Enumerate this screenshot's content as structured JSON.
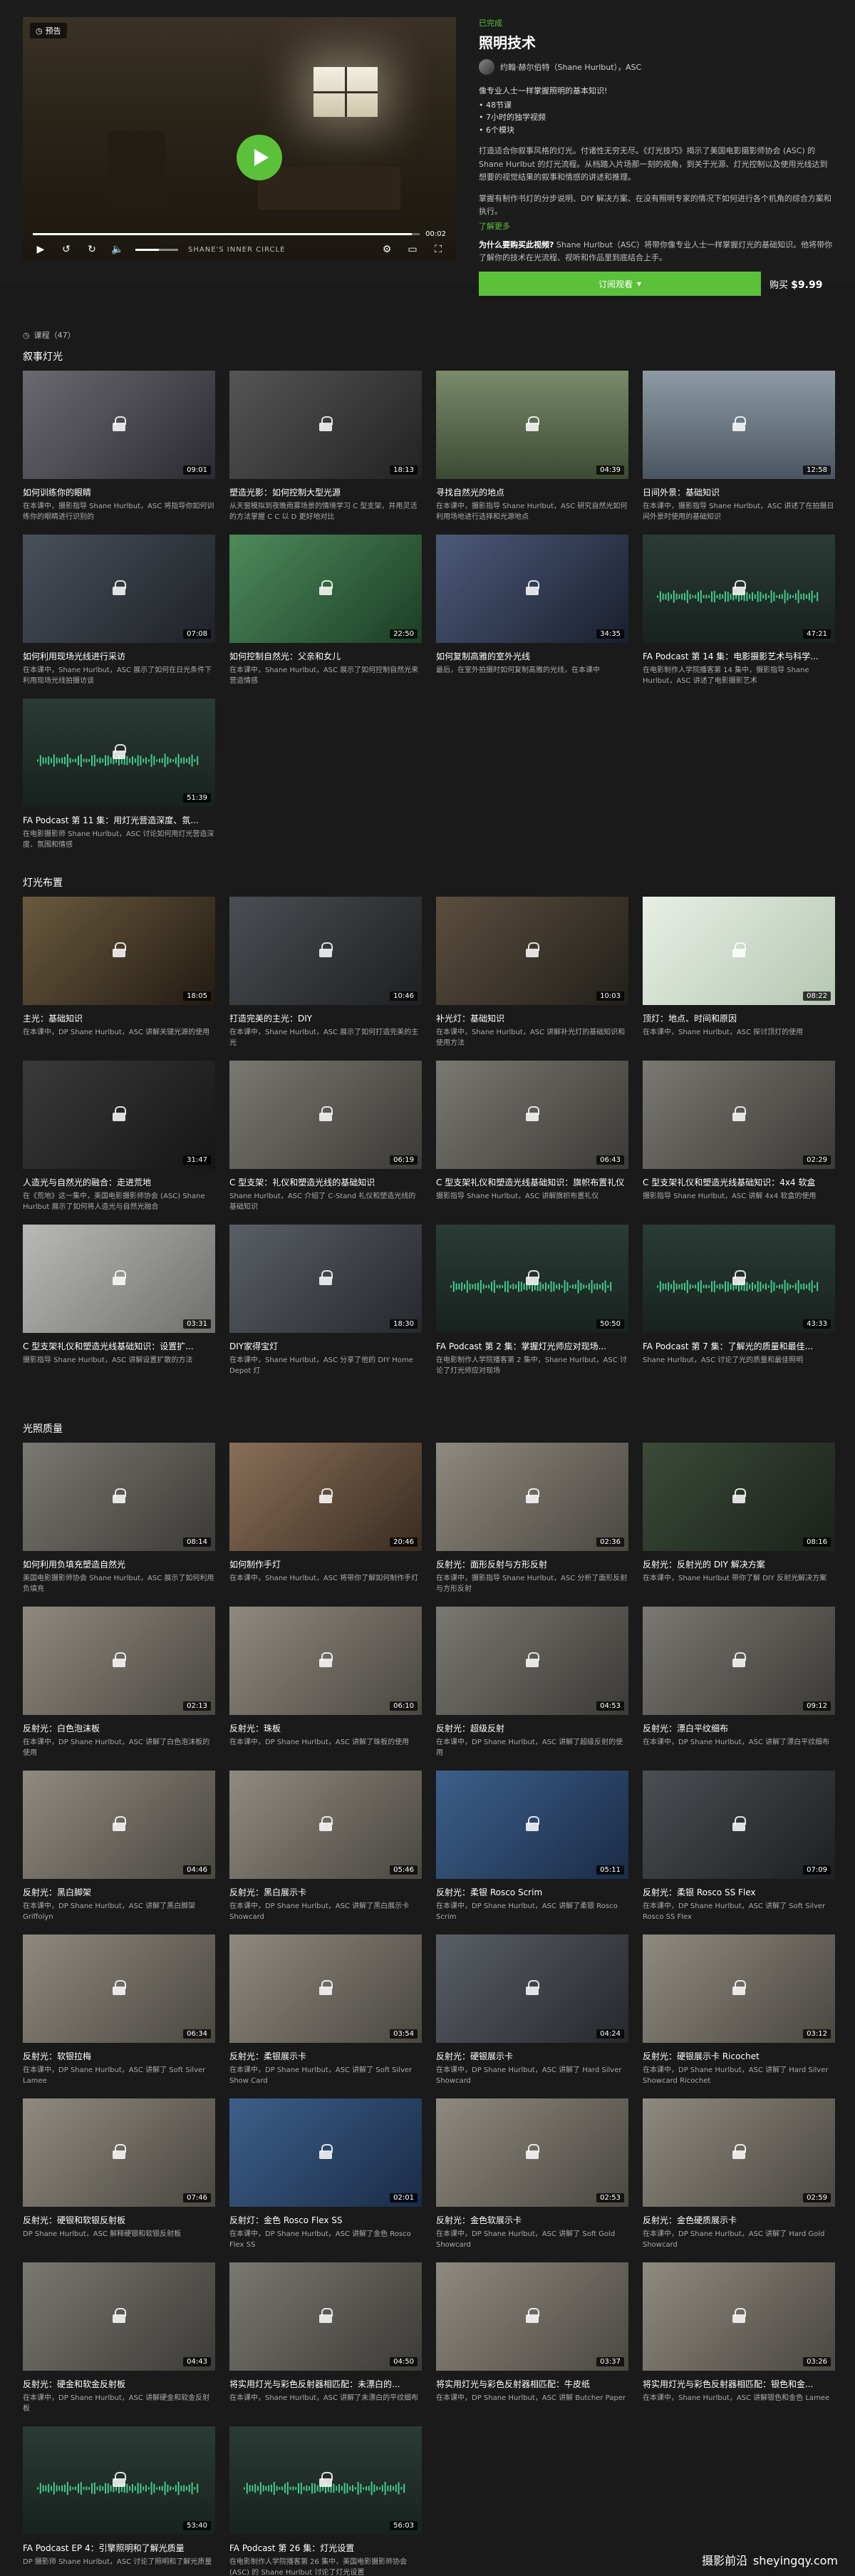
{
  "player": {
    "badge": "预告",
    "time_total": "00:02",
    "progress": 0.98,
    "volume": 0.55,
    "watermark": "SHANE'S INNER CIRCLE"
  },
  "course": {
    "status": "已完成",
    "title": "照明技术",
    "instructor": "约翰·赫尔伯特（Shane Hurlbut），ASC",
    "lead": "像专业人士一样掌握照明的基本知识!",
    "bullets": [
      "48节课",
      "7小时的独学视频",
      "6个模块"
    ],
    "desc1": "打造适合你叙事风格的灯光。付诸性无穷无尽。《灯光技巧》揭示了美国电影摄影师协会 (ASC) 的 Shane Hurlbut 的灯光流程。从档踏入片场那一刻的视角，到关于光源、灯光控制以及使用光线达到想要的视觉结果的叙事和情感的讲述和推理。",
    "desc2": "掌握有制作书灯的分步说明、DIY 解决方案、在没有照明专家的情况下如何进行各个机角的综合方案和执行。",
    "more": "了解更多",
    "why_label": "为什么要购买此视频?",
    "why_text": "Shane Hurlbut（ASC）将带你像专业人士一样掌握灯光的基础知识。他将带你了解你的技术在光流程、视听和作品里到底结合上手。",
    "subscribe": "订阅观看",
    "buy_label": "购买",
    "price": "$9.99"
  },
  "lessons_count": "课程（47）",
  "sections": [
    {
      "title": "叙事灯光",
      "cards": [
        {
          "title": "如何训练你的眼睛",
          "desc": "在本课中，摄影指导 Shane Hurlbut，ASC 将指导你如何训练你的眼睛进行识别的",
          "dur": "09:01",
          "theme": "woman"
        },
        {
          "title": "塑造光影：如何控制大型光源",
          "desc": "从天窗模拟到夜晚雨雾场景的情境学习 C 型支架，并用灵活的方法掌握 C C 以 D 更好地对比",
          "dur": "18:13",
          "theme": "shaping"
        },
        {
          "title": "寻找自然光的地点",
          "desc": "在本课中，摄影指导 Shane Hurlbut，ASC 研究自然光如何利用场地进行选择和光源地点",
          "dur": "04:39",
          "theme": "outdoor"
        },
        {
          "title": "日间外景：基础知识",
          "desc": "在本课中，摄影指导 Shane Hurlbut，ASC 讲述了在拍摄日间外景时使用的基础知识",
          "dur": "12:58",
          "theme": "street"
        },
        {
          "title": "如何利用现场光线进行采访",
          "desc": "在本课中，Shane Hurlbut，ASC 展示了如何在日光条件下利用现场光线拍摄访谈",
          "dur": "07:08",
          "theme": "interview"
        },
        {
          "title": "如何控制自然光：父亲和女儿",
          "desc": "在本课中，Shane Hurlbut，ASC 展示了如何控制自然光来营造情感",
          "dur": "22:50",
          "theme": "green"
        },
        {
          "title": "如何复制高雅的室外光线",
          "desc": "最后，在室外拍摄时如何复制高雅的光线，在本课中",
          "dur": "34:35",
          "theme": "twoshot"
        },
        {
          "title": "FA Podcast 第 14 集：电影摄影艺术与科学...",
          "desc": "在电影制作人学院播客第 14 集中，摄影指导 Shane Hurlbut，ASC 讲述了电影摄影艺术",
          "dur": "47:21",
          "theme": "podcast"
        },
        {
          "title": "FA Podcast 第 11 集：用灯光营造深度、氛...",
          "desc": "在电影摄影师 Shane Hurlbut，ASC 讨论如何用灯光营造深度、氛围和情感",
          "dur": "51:39",
          "theme": "podcast"
        }
      ]
    },
    {
      "title": "灯光布置",
      "cards": [
        {
          "title": "主光：基础知识",
          "desc": "在本课中，DP Shane Hurlbut，ASC 讲解关键光源的使用",
          "dur": "18:05",
          "theme": "window"
        },
        {
          "title": "打造完美的主光：DIY",
          "desc": "在本课中，Shane Hurlbut，ASC 展示了如何打造完美的主光",
          "dur": "10:46",
          "theme": "man"
        },
        {
          "title": "补光灯：基础知识",
          "desc": "在本课中，Shane Hurlbut，ASC 讲解补光灯的基础知识和使用方法",
          "dur": "10:03",
          "theme": "room"
        },
        {
          "title": "顶灯：地点、时间和原因",
          "desc": "在本课中，Shane Hurlbut，ASC 探讨顶灯的使用",
          "dur": "08:22",
          "theme": "slide"
        },
        {
          "title": "人造光与自然光的融合：走进荒地",
          "desc": "在《荒地》这一集中，美国电影摄影师协会 (ASC) Shane Hurlbut 展示了如何将人造光与自然光融合",
          "dur": "31:47",
          "theme": "onset"
        },
        {
          "title": "C 型支架：礼仪和塑造光线的基础知识",
          "desc": "Shane Hurlbut，ASC 介绍了 C-Stand 礼仪和塑造光线的基础知识",
          "dur": "06:19",
          "theme": "studio"
        },
        {
          "title": "C 型支架礼仪和塑造光线基础知识：旗帜布置礼仪",
          "desc": "摄影指导 Shane Hurlbut，ASC 讲解旗帜布置礼仪",
          "dur": "06:43",
          "theme": "studio"
        },
        {
          "title": "C 型支架礼仪和塑造光线基础知识：4x4 软盒",
          "desc": "摄影指导 Shane Hurlbut，ASC 讲解 4x4 软盒的使用",
          "dur": "02:29",
          "theme": "studio"
        },
        {
          "title": "C 型支架礼仪和塑造光线基础知识：设置扩...",
          "desc": "摄影指导 Shane Hurlbut，ASC 讲解设置扩散的方法",
          "dur": "03:31",
          "theme": "white"
        },
        {
          "title": "DIY家得宝灯",
          "desc": "在本课中，Shane Hurlbut，ASC 分享了他的 DIY Home Depot 灯",
          "dur": "18:30",
          "theme": "man2"
        },
        {
          "title": "FA Podcast 第 2 集：掌握灯光师应对现场...",
          "desc": "在电影制作人学院播客第 2 集中，Shane Hurlbut，ASC 讨论了灯光师应对现场",
          "dur": "50:50",
          "theme": "podcast"
        },
        {
          "title": "FA Podcast 第 7 集：了解光的质量和最佳...",
          "desc": "Shane Hurlbut，ASC 讨论了光的质量和最佳照明",
          "dur": "43:33",
          "theme": "podcast"
        }
      ]
    },
    {
      "title": "光照质量",
      "cards": [
        {
          "title": "如何利用负填充塑造自然光",
          "desc": "美国电影摄影师协会 Shane Hurlbut，ASC 展示了如何利用负填充",
          "dur": "08:14",
          "theme": "studio"
        },
        {
          "title": "如何制作手灯",
          "desc": "在本课中，Shane Hurlbut，ASC 将带你了解如何制作手灯",
          "dur": "20:46",
          "theme": "hands"
        },
        {
          "title": "反射光：面形反射与方形反射",
          "desc": "在本课中，摄影指导 Shane Hurlbut，ASC 分析了面形反射与方形反射",
          "dur": "02:36",
          "theme": "blonde"
        },
        {
          "title": "反射光：反射光的 DIY 解决方案",
          "desc": "在本课中，Shane Hurlbut 带你了解 DIY 反射光解决方案",
          "dur": "08:16",
          "theme": "diy"
        },
        {
          "title": "反射光：白色泡沫板",
          "desc": "在本课中，DP Shane Hurlbut，ASC 讲解了白色泡沫板的使用",
          "dur": "02:13",
          "theme": "blonde"
        },
        {
          "title": "反射光：珠板",
          "desc": "在本课中，DP Shane Hurlbut，ASC 讲解了珠板的使用",
          "dur": "06:10",
          "theme": "blonde"
        },
        {
          "title": "反射光：超级反射",
          "desc": "在本课中，DP Shane Hurlbut，ASC 讲解了超级反射的使用",
          "dur": "04:53",
          "theme": "studio"
        },
        {
          "title": "反射光：漂白平纹细布",
          "desc": "在本课中，DP Shane Hurlbut，ASC 讲解了漂白平纹细布",
          "dur": "09:12",
          "theme": "studio"
        },
        {
          "title": "反射光：黑白脚架",
          "desc": "在本课中，DP Shane Hurlbut，ASC 讲解了黑白脚架 Griffolyn",
          "dur": "04:46",
          "theme": "blonde"
        },
        {
          "title": "反射光：黑白展示卡",
          "desc": "在本课中，DP Shane Hurlbut，ASC 讲解了黑白展示卡 Showcard",
          "dur": "05:46",
          "theme": "blonde"
        },
        {
          "title": "反射光：柔银 Rosco Scrim",
          "desc": "在本课中，DP Shane Hurlbut，ASC 讲解了柔银 Rosco Scrim",
          "dur": "05:11",
          "theme": "blue"
        },
        {
          "title": "反射光：柔银 Rosco SS Flex",
          "desc": "在本课中，DP Shane Hurlbut，ASC 讲解了 Soft Silver Rosco SS Flex",
          "dur": "07:09",
          "theme": "man"
        },
        {
          "title": "反射光：软银拉梅",
          "desc": "在本课中，DP Shane Hurlbut，ASC 讲解了 Soft Silver Lamee",
          "dur": "06:34",
          "theme": "blonde"
        },
        {
          "title": "反射光：柔银展示卡",
          "desc": "在本课中，DP Shane Hurlbut，ASC 讲解了 Soft Silver Show Card",
          "dur": "03:54",
          "theme": "blonde"
        },
        {
          "title": "反射光：硬银展示卡",
          "desc": "在本课中，DP Shane Hurlbut，ASC 讲解了 Hard Silver Showcard",
          "dur": "04:24",
          "theme": "man2"
        },
        {
          "title": "反射光：硬银展示卡 Ricochet",
          "desc": "在本课中，DP Shane Hurlbut，ASC 讲解了 Hard Silver Showcard Ricochet",
          "dur": "03:12",
          "theme": "blonde"
        },
        {
          "title": "反射光：硬银和软银反射板",
          "desc": "DP Shane Hurlbut，ASC 解释硬银和软银反射板",
          "dur": "07:46",
          "theme": "blonde"
        },
        {
          "title": "反射灯：金色 Rosco Flex SS",
          "desc": "在本课中，DP Shane Hurlbut，ASC 讲解了金色 Rosco Flex SS",
          "dur": "02:01",
          "theme": "blue"
        },
        {
          "title": "反射光：金色软展示卡",
          "desc": "在本课中，DP Shane Hurlbut，ASC 讲解了 Soft Gold Showcard",
          "dur": "02:53",
          "theme": "blonde"
        },
        {
          "title": "反射光：金色硬质展示卡",
          "desc": "在本课中，DP Shane Hurlbut，ASC 讲解了 Hard Gold Showcard",
          "dur": "02:59",
          "theme": "blonde"
        },
        {
          "title": "反射光：硬金和软金反射板",
          "desc": "在本课中，DP Shane Hurlbut，ASC 讲解硬金和软金反射板",
          "dur": "04:43",
          "theme": "studio"
        },
        {
          "title": "将实用灯光与彩色反射器相匹配：未漂白的...",
          "desc": "在本课中，Shane Hurlbut，ASC 讲解了未漂白的平纹细布",
          "dur": "04:50",
          "theme": "studio"
        },
        {
          "title": "将实用灯光与彩色反射器相匹配：牛皮纸",
          "desc": "在本课中，DP Shane Hurlbut，ASC 讲解 Butcher Paper",
          "dur": "03:37",
          "theme": "blonde"
        },
        {
          "title": "将实用灯光与彩色反射器相匹配：银色和金...",
          "desc": "在本课中，Shane Hurlbut，ASC 讲解银色和金色 Lamee",
          "dur": "03:26",
          "theme": "blonde"
        },
        {
          "title": "FA Podcast EP 4：引擎照明和了解光质量",
          "desc": "DP 摄影师 Shane Hurlbut，ASC 讨论了照明和了解光质量",
          "dur": "53:40",
          "theme": "podcast"
        },
        {
          "title": "FA Podcast 第 26 集：灯光设置",
          "desc": "在电影制作人学院播客第 26 集中，美国电影摄影师协会 (ASC) 的 Shane Hurlbut 讨论了灯光设置",
          "dur": "56:03",
          "theme": "podcast"
        }
      ]
    }
  ],
  "footer_watermark": "摄影前沿",
  "footer_watermark_url": "sheyingqy.com",
  "colors": {
    "accent": "#5cc13a",
    "bg": "#1a1a1a"
  }
}
